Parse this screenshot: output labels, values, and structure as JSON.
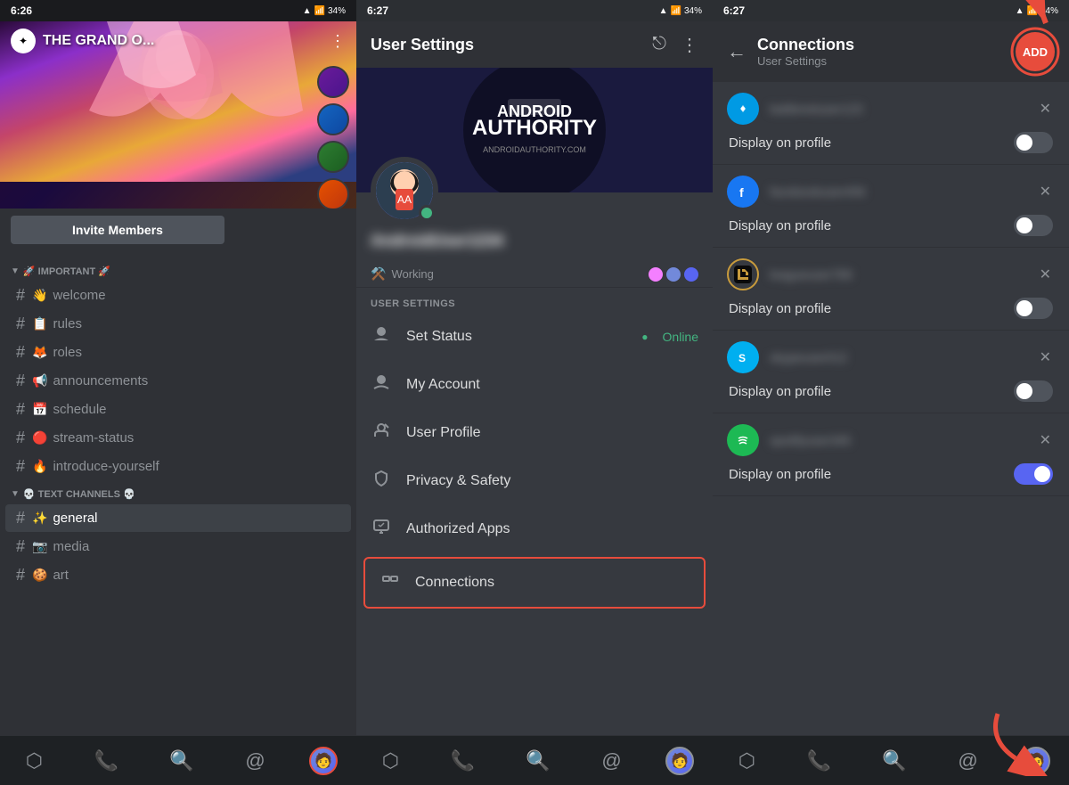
{
  "panel1": {
    "status_bar": {
      "time": "6:26",
      "battery": "34%"
    },
    "server": {
      "name": "THE GRAND O...",
      "invite_button": "Invite Members"
    },
    "sections": [
      {
        "label": "🚀 IMPORTANT 🚀",
        "channels": [
          {
            "emoji": "👋",
            "name": "welcome"
          },
          {
            "emoji": "📋",
            "name": "rules"
          },
          {
            "emoji": "🦊",
            "name": "roles"
          },
          {
            "emoji": "📢",
            "name": "announcements"
          },
          {
            "emoji": "📅",
            "name": "schedule"
          },
          {
            "emoji": "🔴",
            "name": "stream-status"
          },
          {
            "emoji": "🔥",
            "name": "introduce-yourself"
          }
        ]
      },
      {
        "label": "💀 TEXT CHANNELS 💀",
        "channels": [
          {
            "emoji": "✨",
            "name": "general",
            "active": true
          },
          {
            "emoji": "📷",
            "name": "media"
          },
          {
            "emoji": "🍪",
            "name": "art"
          }
        ]
      }
    ],
    "bottom_nav": {
      "icons": [
        "discord-icon",
        "phone-icon",
        "search-icon",
        "mention-icon",
        "profile-icon"
      ]
    }
  },
  "panel2": {
    "status_bar": {
      "time": "6:27",
      "battery": "34%"
    },
    "header": {
      "title": "User Settings",
      "icons": [
        "exit-icon",
        "more-icon"
      ]
    },
    "profile": {
      "username": "AndroidUser1234",
      "status": "Working",
      "status_emoji": "⚒️"
    },
    "settings_section": "USER SETTINGS",
    "settings_items": [
      {
        "icon": "👤",
        "label": "Set Status",
        "right": "Online",
        "right_type": "online"
      },
      {
        "icon": "👤",
        "label": "My Account",
        "right": ""
      },
      {
        "icon": "✏️",
        "label": "User Profile",
        "right": ""
      },
      {
        "icon": "🔒",
        "label": "Privacy & Safety",
        "right": ""
      },
      {
        "icon": "🖥️",
        "label": "Authorized Apps",
        "right": ""
      },
      {
        "icon": "🔗",
        "label": "Connections",
        "right": "",
        "highlighted": true
      }
    ],
    "bottom_nav": {
      "icons": [
        "discord-icon",
        "phone-icon",
        "search-icon",
        "mention-icon",
        "profile-icon"
      ]
    }
  },
  "panel3": {
    "status_bar": {
      "time": "6:27",
      "battery": "34%"
    },
    "header": {
      "back_label": "←",
      "title": "Connections",
      "subtitle": "User Settings",
      "add_button": "ADD"
    },
    "connections": [
      {
        "service": "battlenet",
        "icon_label": "⚛",
        "icon_class": "icon-battlenet",
        "username_blur": "battlenetuser123",
        "display_on_profile": "Display on profile",
        "toggle_on": false
      },
      {
        "service": "facebook",
        "icon_label": "f",
        "icon_class": "icon-facebook",
        "username_blur": "facebookuser456",
        "display_on_profile": "Display on profile",
        "toggle_on": false
      },
      {
        "service": "league",
        "icon_label": "⚔",
        "icon_class": "icon-league",
        "username_blur": "leagueuser789",
        "display_on_profile": "Display on profile",
        "toggle_on": false
      },
      {
        "service": "skype",
        "icon_label": "S",
        "icon_class": "icon-skype",
        "username_blur": "skypeuser012",
        "display_on_profile": "Display on profile",
        "toggle_on": false
      },
      {
        "service": "spotify",
        "icon_label": "♪",
        "icon_class": "icon-spotify",
        "username_blur": "spotifyuser345",
        "display_on_profile": "Display on profile",
        "toggle_on": true
      }
    ]
  }
}
